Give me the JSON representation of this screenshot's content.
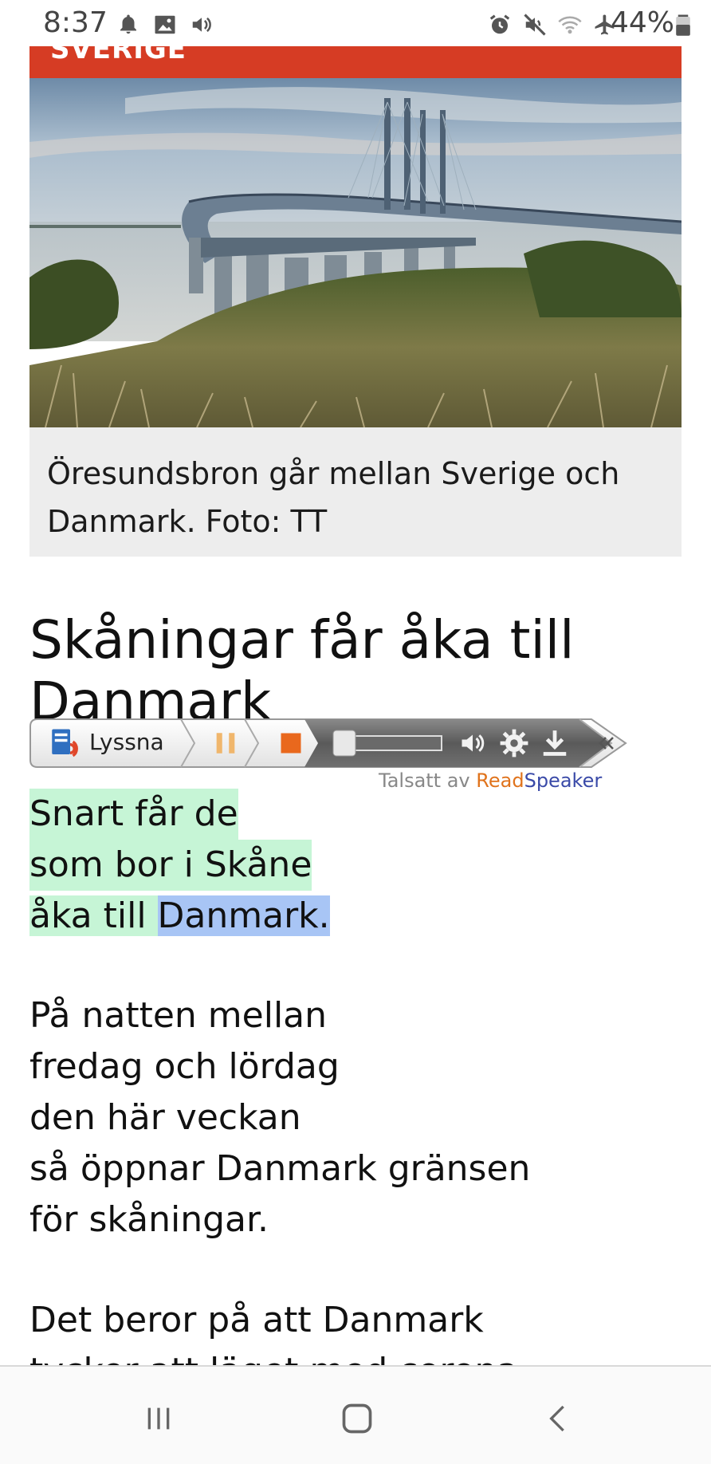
{
  "status_bar": {
    "time": "8:37",
    "battery": "44%",
    "left_icons": [
      "notification-bell-icon",
      "image-icon",
      "volume-icon"
    ],
    "right_icons": [
      "alarm-icon",
      "mute-icon",
      "wifi-icon",
      "airplane-icon",
      "battery-icon"
    ]
  },
  "article": {
    "category": "SVERIGE",
    "image_caption": "Öresundsbron går mellan Sverige och Danmark. Foto: TT",
    "headline": "Skåningar får åka till Danmark",
    "paragraph1": {
      "lines": [
        "Snart får de",
        "som bor i Skåne",
        "åka till "
      ],
      "highlighted_word": "Danmark",
      "end": "."
    },
    "paragraph2": {
      "lines": [
        "På natten mellan",
        "fredag och lördag",
        "den här veckan",
        "så öppnar Danmark gränsen",
        "för skåningar."
      ]
    },
    "paragraph3": {
      "lines": [
        "Det beror på att Danmark",
        "tycker att läget med corona"
      ]
    }
  },
  "readspeaker": {
    "listen_label": "Lyssna",
    "credit_prefix": "Talsatt av ",
    "credit_read": "Read",
    "credit_speaker": "Speaker",
    "controls": [
      "pause-icon",
      "stop-icon",
      "volume-icon",
      "settings-icon",
      "download-icon",
      "collapse-icon"
    ]
  },
  "nav_bar": {
    "buttons": [
      "recent-apps",
      "home",
      "back"
    ]
  }
}
